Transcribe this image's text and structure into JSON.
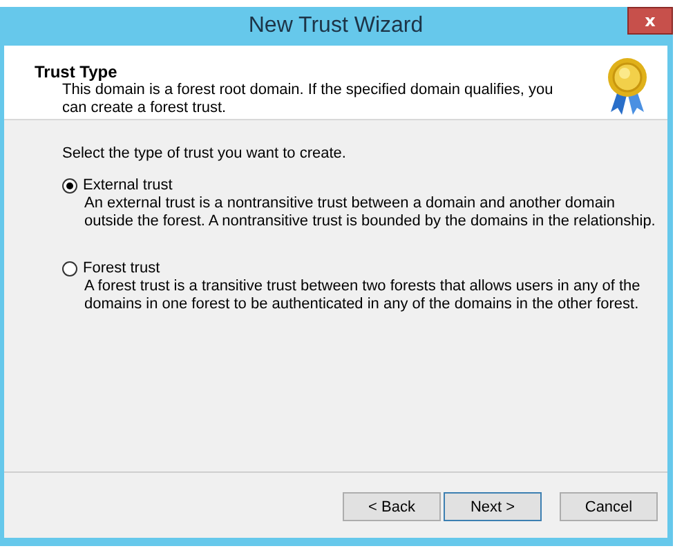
{
  "window": {
    "title": "New Trust Wizard",
    "close": "x"
  },
  "header": {
    "title": "Trust Type",
    "description": "This domain is a forest root domain. If the specified domain qualifies, you can create a forest trust."
  },
  "prompt": "Select the type of trust you want to create.",
  "options": [
    {
      "label": "External trust",
      "selected": true,
      "description": "An external trust is a nontransitive trust between a domain and another domain outside the forest. A nontransitive trust is bounded by the domains in the relationship."
    },
    {
      "label": "Forest trust",
      "selected": false,
      "description": "A forest trust is a transitive trust between two forests that allows users in any of the domains in one forest to be authenticated in any of the domains in the other forest."
    }
  ],
  "buttons": [
    {
      "label": "< Back",
      "default": false
    },
    {
      "label": "Next >",
      "default": true
    },
    {
      "label": "Cancel",
      "default": false
    }
  ]
}
